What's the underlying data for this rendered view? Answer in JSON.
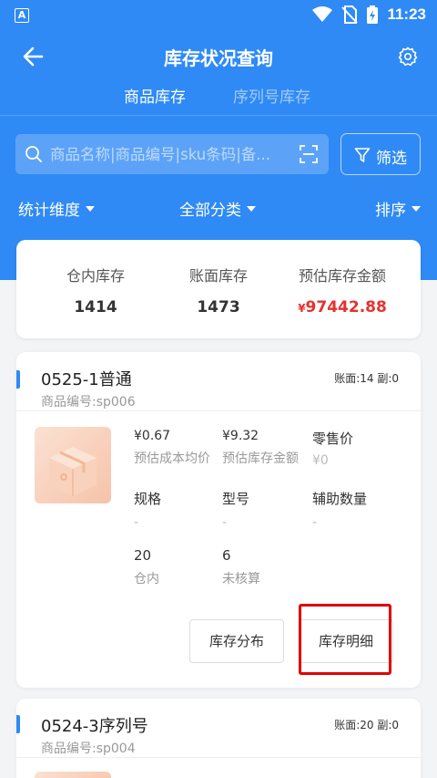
{
  "status_bar": {
    "time": "11:23",
    "app_badge": "A"
  },
  "header": {
    "title": "库存状况查询",
    "back_icon": "back-arrow-icon",
    "settings_icon": "gear-icon"
  },
  "tabs": [
    {
      "label": "商品库存",
      "active": true
    },
    {
      "label": "序列号库存",
      "active": false
    }
  ],
  "search": {
    "placeholder": "商品名称|商品编号|sku条码|备...",
    "filter_label": "筛选"
  },
  "dropdowns": {
    "dimension": "统计维度",
    "category": "全部分类",
    "sort": "排序"
  },
  "summary": {
    "warehouse_label": "仓内库存",
    "warehouse_value": "1414",
    "book_label": "账面库存",
    "book_value": "1473",
    "amount_label": "预估库存金额",
    "amount_symbol": "¥",
    "amount_value": "97442.88"
  },
  "products": [
    {
      "name": "0525-1普通",
      "code_label": "商品编号:",
      "code": "sp006",
      "counts": "账面:14 副:0",
      "avg_cost": "¥0.67",
      "avg_cost_label": "预估成本均价",
      "stock_amount": "¥9.32",
      "stock_amount_label": "预估库存金额",
      "retail_label": "零售价",
      "retail_value": "¥0",
      "spec_label": "规格",
      "spec_value": "-",
      "model_label": "型号",
      "model_value": "-",
      "aux_label": "辅助数量",
      "aux_value": "-",
      "in_wh_value": "20",
      "in_wh_label": "仓内",
      "unchecked_value": "6",
      "unchecked_label": "未核算",
      "btn_distribution": "库存分布",
      "btn_detail": "库存明细"
    },
    {
      "name": "0524-3序列号",
      "code_label": "商品编号:",
      "code": "sp004",
      "counts": "账面:20 副:0"
    }
  ]
}
